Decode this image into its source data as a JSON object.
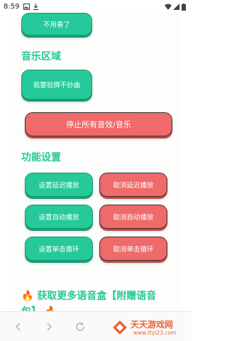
{
  "status_bar": {
    "time": "8:59",
    "icons": [
      "image-notification-icon",
      "download-notification-icon",
      "wifi-icon",
      "signal-icon",
      "battery-icon"
    ]
  },
  "buttons": {
    "no_need_look": "不用看了",
    "lose_bad_song": "我要验牌不妙曲",
    "stop_all": "停止所有音效/音乐",
    "set_delay": "设置延迟播放",
    "cancel_delay": "取消延迟播放",
    "set_auto": "设置自动播放",
    "cancel_auto": "取消自动播放",
    "set_single_loop": "设置单击循环",
    "cancel_single_loop": "取消单击循环"
  },
  "sections": {
    "music": "音乐区域",
    "settings": "功能设置"
  },
  "promo": {
    "text": "获取更多语音盒【附赠语音包】"
  },
  "watermark": {
    "title": "天天游戏网",
    "url": "www.ttyl23.com"
  },
  "colors": {
    "accent_green": "#25c99a",
    "accent_red": "#ef6a6a",
    "watermark_orange": "#e8663c"
  }
}
